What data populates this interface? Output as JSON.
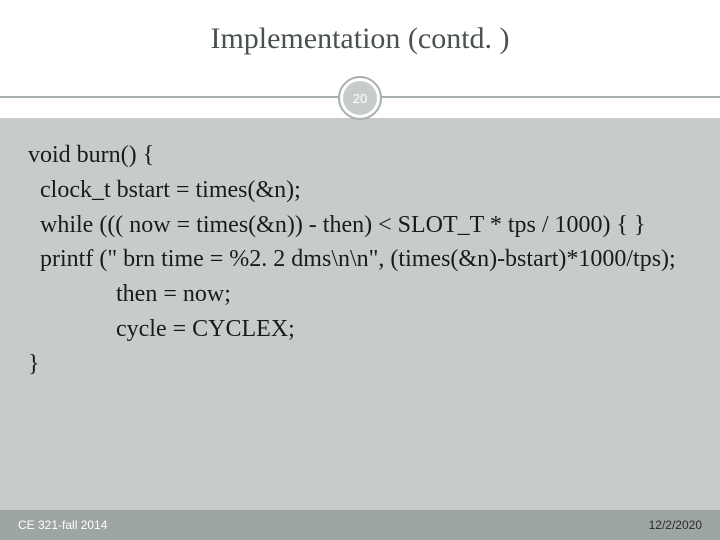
{
  "slide": {
    "title": "Implementation (contd. )",
    "page_number": "20",
    "code": {
      "l1": "void burn() {",
      "l2": " clock_t bstart = times(&n);",
      "l3": " while ((( now = times(&n)) - then) < SLOT_T * tps / 1000) { }",
      "l4": " printf (\" brn time = %2. 2 dms\\n\\n\", (times(&n)-bstart)*1000/tps);",
      "l5": "then = now;",
      "l6": "cycle = CYCLEX;",
      "l7": "}"
    },
    "footer_left": "CE 321-fall 2014",
    "footer_right": "12/2/2020"
  }
}
